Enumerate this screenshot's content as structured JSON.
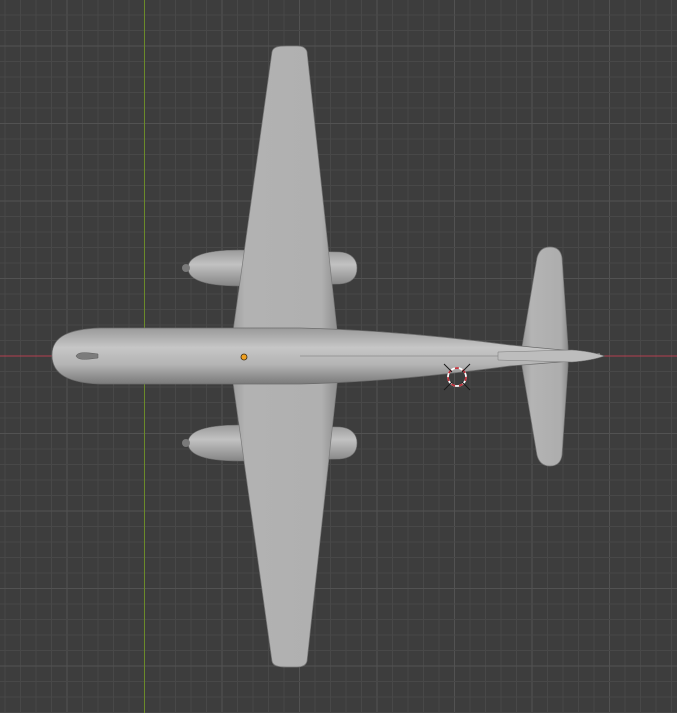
{
  "viewport": {
    "background_color": "#3d3d3d",
    "grid_minor_color": "#484848",
    "grid_major_color": "#525252",
    "x_axis_color": "#b4404f",
    "y_axis_color": "#6b8a2a",
    "model_color": "#a8a8a8",
    "model_highlight_color": "#c4c4c4",
    "model_shadow_color": "#8a8a8a",
    "origin_dot_color": "#f0a020",
    "cursor_ring_colors": [
      "#c0303a",
      "#ffffff"
    ],
    "cursor_icon": "3d-cursor-icon",
    "origin_icon": "object-origin-icon",
    "model_name": "airplane-mesh"
  }
}
